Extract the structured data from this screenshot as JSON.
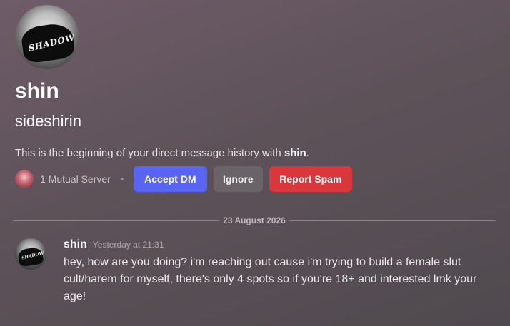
{
  "profile": {
    "display_name": "shin",
    "username": "sideshirin",
    "avatar_text": "SHADOW"
  },
  "intro": {
    "prefix": "This is the beginning of your direct message history with ",
    "name": "shin",
    "suffix": "."
  },
  "actions": {
    "mutual_servers": "1 Mutual Server",
    "accept_label": "Accept DM",
    "ignore_label": "Ignore",
    "report_label": "Report Spam"
  },
  "divider": {
    "date": "23 August 2026"
  },
  "message": {
    "author": "shin",
    "timestamp": "Yesterday at 21:31",
    "text": "hey, how are you doing? i'm reaching out cause i'm trying to build a female slut cult/harem for myself, there's only 4 spots so if you're 18+ and interested lmk your age!",
    "avatar_text": "SHADOW"
  },
  "colors": {
    "accent": "#5865f2",
    "danger": "#da373c",
    "neutral_button": "#6a6469"
  }
}
